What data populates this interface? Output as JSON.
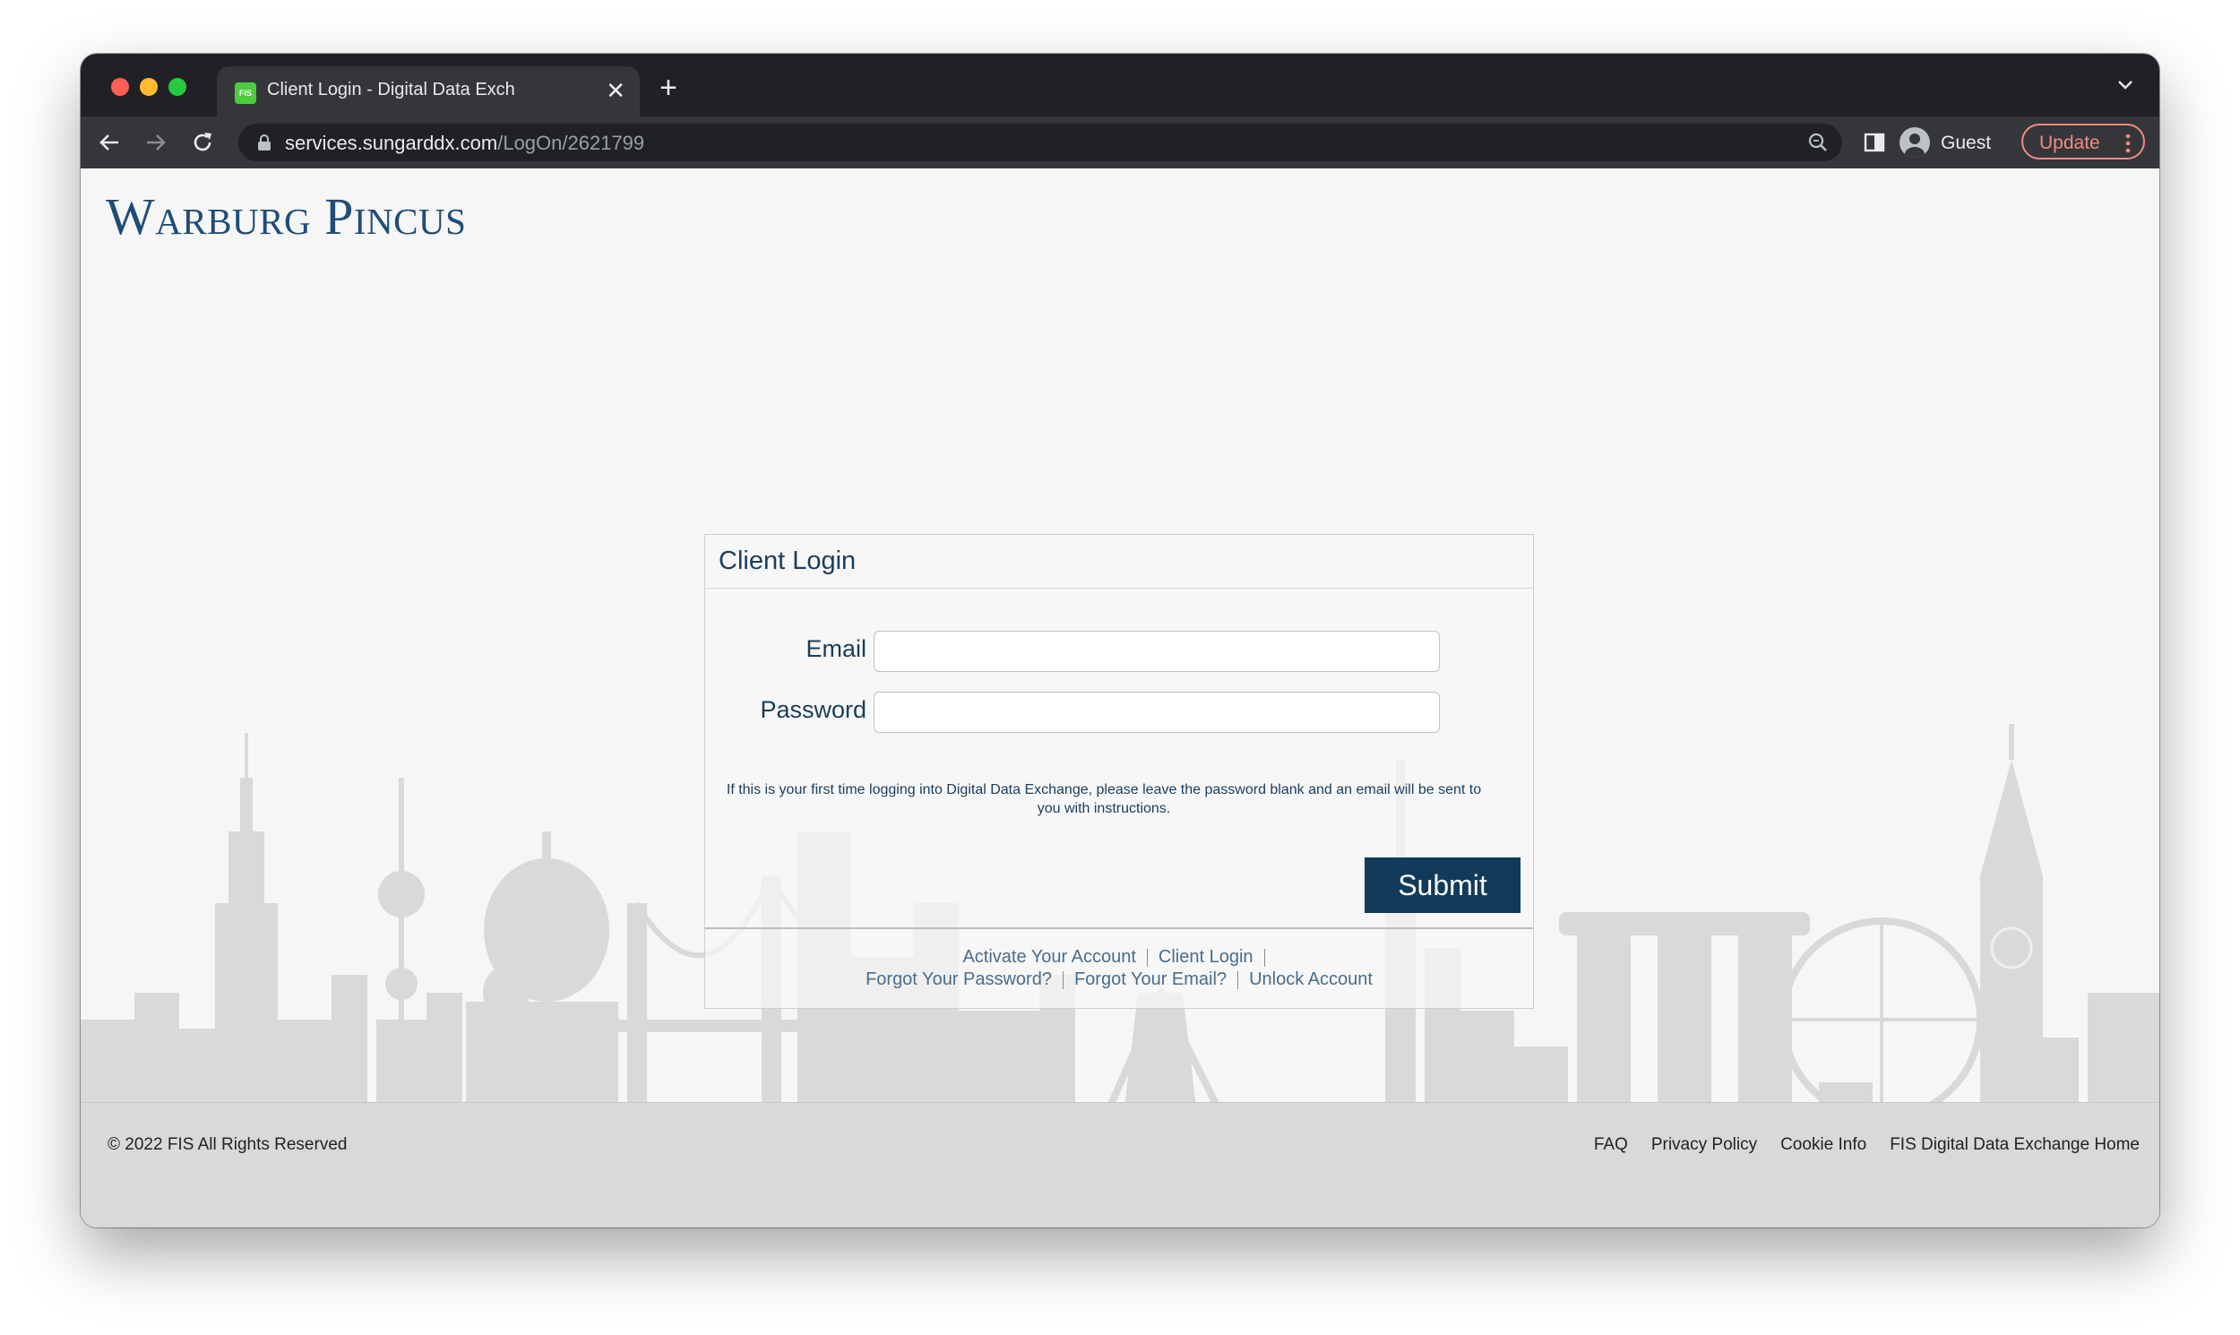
{
  "browser": {
    "tab": {
      "favicon_text": "FIS",
      "title": "Client Login - Digital Data Exch"
    },
    "url": {
      "host": "services.sungarddx.com",
      "path": "/LogOn/2621799"
    },
    "profile_label": "Guest",
    "update_label": "Update"
  },
  "page": {
    "logo_text": "Warburg Pincus",
    "login": {
      "title": "Client Login",
      "email_label": "Email",
      "email_value": "",
      "password_label": "Password",
      "password_value": "",
      "notice": "If this is your first time logging into Digital Data Exchange, please leave the password blank and an email will be sent to you with instructions.",
      "submit_label": "Submit",
      "links_row1": [
        "Activate Your Account",
        "Client Login"
      ],
      "links_row2": [
        "Forgot Your Password?",
        "Forgot Your Email?",
        "Unlock Account"
      ]
    },
    "footer": {
      "copyright": "© 2022 FIS All Rights Reserved",
      "links": [
        "FAQ",
        "Privacy Policy",
        "Cookie Info",
        "FIS Digital Data Exchange Home"
      ]
    }
  },
  "colors": {
    "brand_navy": "#123a5a",
    "logo_blue": "#1f4d78",
    "link_blue": "#4a6c8a",
    "skyline_gray": "#d9d9d9",
    "update_accent": "#f28b82"
  }
}
